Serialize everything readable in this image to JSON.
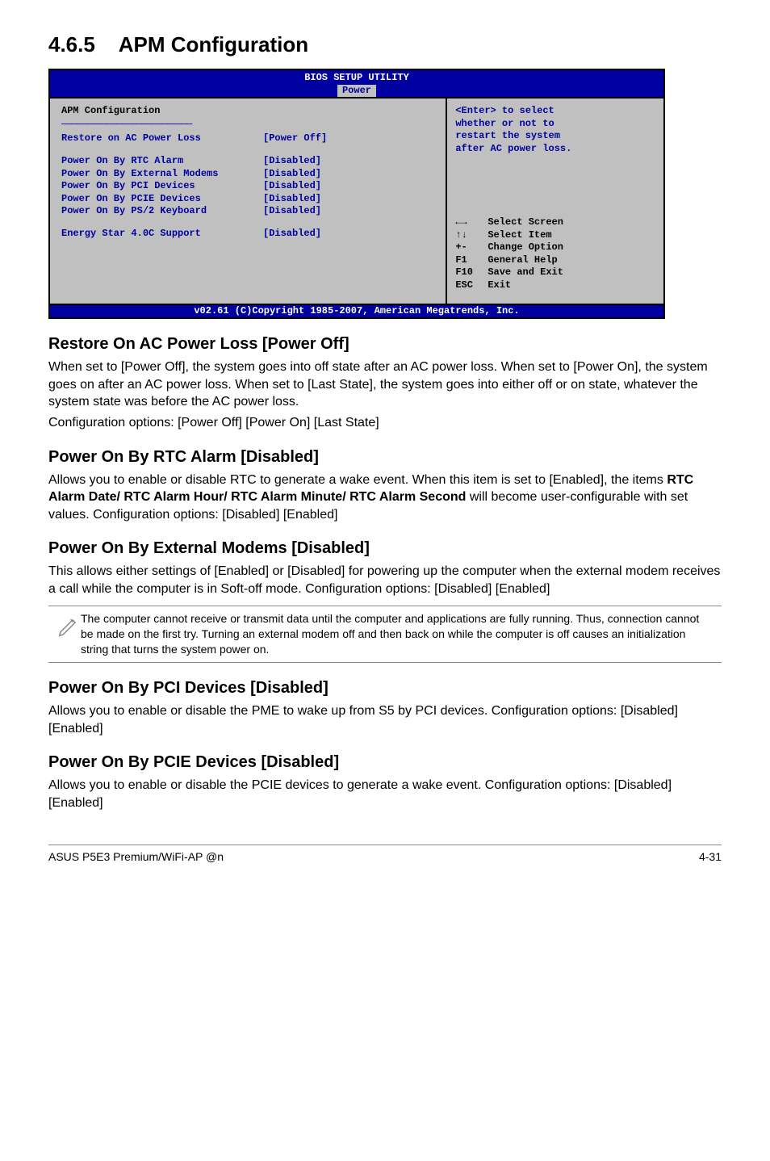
{
  "section_number": "4.6.5",
  "section_title": "APM Configuration",
  "bios": {
    "header_title": "BIOS SETUP UTILITY",
    "tab": "Power",
    "panel_title": "APM Configuration",
    "items": [
      {
        "label": "Restore on AC Power Loss",
        "value": "[Power Off]"
      },
      {
        "label": "Power On By RTC Alarm",
        "value": "[Disabled]"
      },
      {
        "label": "Power On By External Modems",
        "value": "[Disabled]"
      },
      {
        "label": "Power On By PCI Devices",
        "value": "[Disabled]"
      },
      {
        "label": "Power On By PCIE Devices",
        "value": "[Disabled]"
      },
      {
        "label": "Power On By PS/2 Keyboard",
        "value": "[Disabled]"
      },
      {
        "label": "Energy Star 4.0C Support",
        "value": "[Disabled]"
      }
    ],
    "help_text_1": "<Enter> to select",
    "help_text_2": "whether or not to",
    "help_text_3": "restart the system",
    "help_text_4": "after AC power loss.",
    "keys": [
      {
        "sym": "←→",
        "desc": "Select Screen"
      },
      {
        "sym": "↑↓",
        "desc": "Select Item"
      },
      {
        "sym": "+-",
        "desc": "Change Option"
      },
      {
        "sym": "F1",
        "desc": "General Help"
      },
      {
        "sym": "F10",
        "desc": "Save and Exit"
      },
      {
        "sym": "ESC",
        "desc": "Exit"
      }
    ],
    "footer": "v02.61 (C)Copyright 1985-2007, American Megatrends, Inc."
  },
  "s1": {
    "title": "Restore On AC Power Loss [Power Off]",
    "p1": "When set to [Power Off], the system goes into off state after an AC power loss. When set to [Power On], the system goes on after an AC power loss. When set to [Last State], the system goes into either off or on state, whatever the system state was before the AC power loss.",
    "p2": "Configuration options: [Power Off] [Power On] [Last State]"
  },
  "s2": {
    "title": "Power On By RTC Alarm [Disabled]",
    "p1_a": "Allows you to enable or disable RTC to generate a wake event. When this item is set to [Enabled], the items ",
    "p1_b": "RTC Alarm Date/ RTC Alarm Hour/ RTC Alarm Minute/ RTC Alarm Second",
    "p1_c": " will become user-configurable with set values. Configuration options: [Disabled] [Enabled]"
  },
  "s3": {
    "title": "Power On By External Modems [Disabled]",
    "p1": "This allows either settings of [Enabled] or [Disabled] for powering up the computer when the external modem receives a call while the computer is in Soft-off mode. Configuration options: [Disabled] [Enabled]",
    "note": "The computer cannot receive or transmit data until the computer and applications are fully running. Thus, connection cannot be made on the first try. Turning an external modem off and then back on while the computer is off causes an initialization string that turns the system power on."
  },
  "s4": {
    "title": "Power On By PCI Devices [Disabled]",
    "p1": "Allows you to enable or disable the PME to wake up from S5 by PCI devices. Configuration options: [Disabled] [Enabled]"
  },
  "s5": {
    "title": "Power On By PCIE Devices [Disabled]",
    "p1": "Allows you to enable or disable the PCIE devices to generate a wake event. Configuration options: [Disabled] [Enabled]"
  },
  "footer": {
    "left": "ASUS P5E3 Premium/WiFi-AP @n",
    "right": "4-31"
  }
}
